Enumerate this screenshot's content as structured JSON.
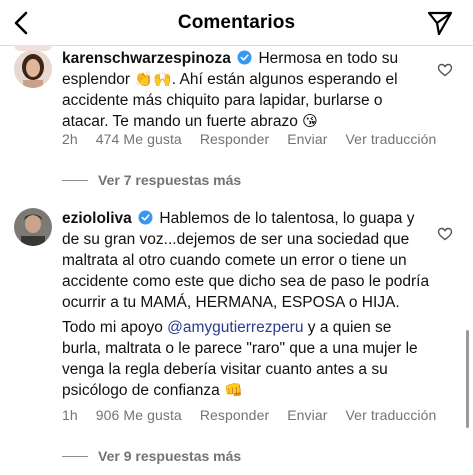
{
  "header": {
    "title": "Comentarios"
  },
  "comments": [
    {
      "username": "karenschwarzespinoza",
      "text_before_emoji": "Hermosa en todo su esplendor",
      "emoji_1": "👏🙌",
      "text_after_emoji": "Ahí están algunos esperando el accidente más chiquito para lapidar, burlarse o atacar. Te mando un fuerte abrazo",
      "emoji_2": "😘",
      "time": "2h",
      "likes": "474 Me gusta",
      "reply": "Responder",
      "send": "Enviar",
      "translate": "Ver traducción",
      "more_replies": "Ver 7 respuestas más"
    },
    {
      "username": "eziololiva",
      "paragraph_1": "Hablemos de lo talentosa, lo guapa y de su gran voz...dejemos de ser una sociedad que maltrata al otro cuando comete un error o tiene un accidente como este que dicho sea de paso le podría ocurrir a tu MAMÁ, HERMANA, ESPOSA o HIJA.",
      "paragraph_2_start": "Todo mi apoyo",
      "mention": "@amygutierrezperu",
      "paragraph_2_end": "y a quien se burla, maltrata o le parece \"raro\" que a una mujer le venga la regla debería visitar cuanto antes a su psicólogo de confianza",
      "emoji": "👊",
      "time": "1h",
      "likes": "906 Me gusta",
      "reply": "Responder",
      "send": "Enviar",
      "translate": "Ver traducción",
      "more_replies": "Ver 9 respuestas más"
    }
  ],
  "colors": {
    "verified": "#3897f0",
    "secondary_text": "#737373",
    "mention": "#2b3b8f"
  }
}
